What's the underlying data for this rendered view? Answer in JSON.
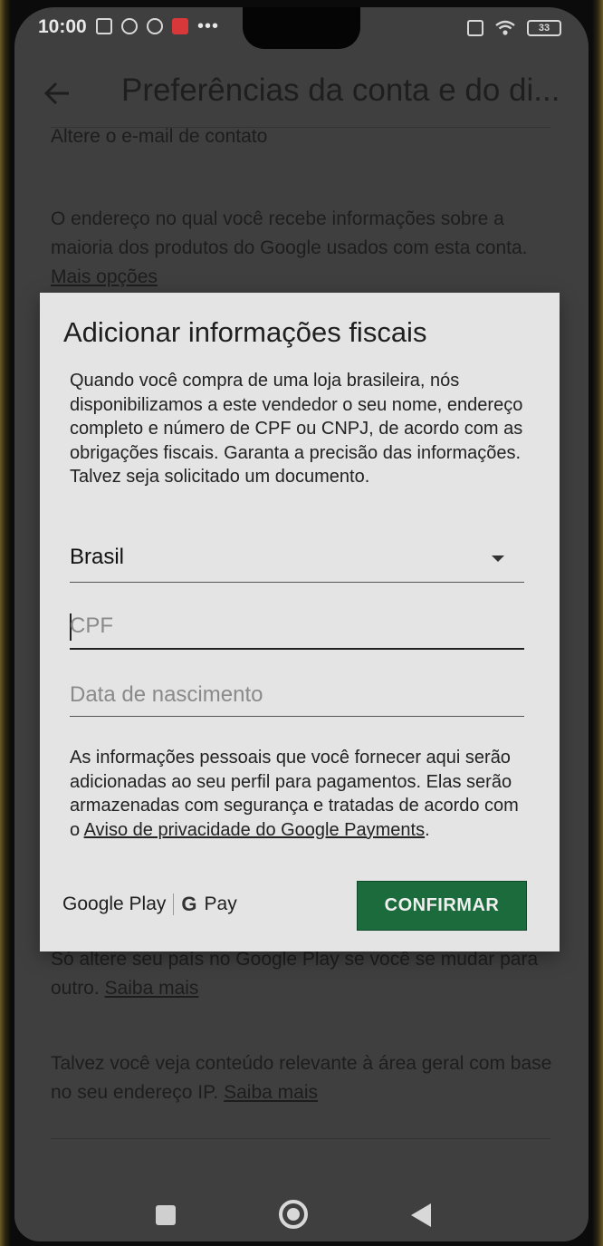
{
  "status_bar": {
    "time": "10:00",
    "battery": "33",
    "icons": [
      "nfc-icon",
      "s-icon",
      "gear-icon",
      "mail-icon",
      "more-icon",
      "sim-icon",
      "wifi-icon",
      "battery-icon"
    ]
  },
  "app_bar": {
    "title": "Preferências da conta e do di..."
  },
  "background": {
    "cut_text": "Altere o e-mail de contato",
    "email_desc": "O endereço no qual você recebe informações sobre a maioria dos produtos do Google usados com esta conta.",
    "email_link": "Mais opções",
    "country_note": "Só altere seu país no Google Play se você se mudar para outro.",
    "country_link": "Saiba mais",
    "ip_note": "Talvez você veja conteúdo relevante à área geral com base no seu endereço IP.",
    "ip_link": "Saiba mais"
  },
  "dialog": {
    "title": "Adicionar informações fiscais",
    "description": "Quando você compra de uma loja brasileira, nós disponibilizamos a este vendedor o seu nome, endereço completo e número de CPF ou CNPJ, de acordo com as obrigações fiscais. Garanta a precisão das informações. Talvez seja solicitado um documento.",
    "country_value": "Brasil",
    "cpf_placeholder": "CPF",
    "dob_placeholder": "Data de nascimento",
    "note": "As informações pessoais que você fornecer aqui serão adicionadas ao seu perfil para pagamentos. Elas serão armazenadas com segurança e tratadas de acordo com o",
    "note_link": "Aviso de privacidade do Google Payments",
    "note_end": ".",
    "brand_play": "Google Play",
    "brand_pay": "Pay",
    "brand_g": "G",
    "confirm_label": "CONFIRMAR"
  },
  "colors": {
    "dialog_bg": "#e4e4e4",
    "confirm_bg": "#1b6b3c",
    "scrim_bg": "#3f3f3f"
  }
}
